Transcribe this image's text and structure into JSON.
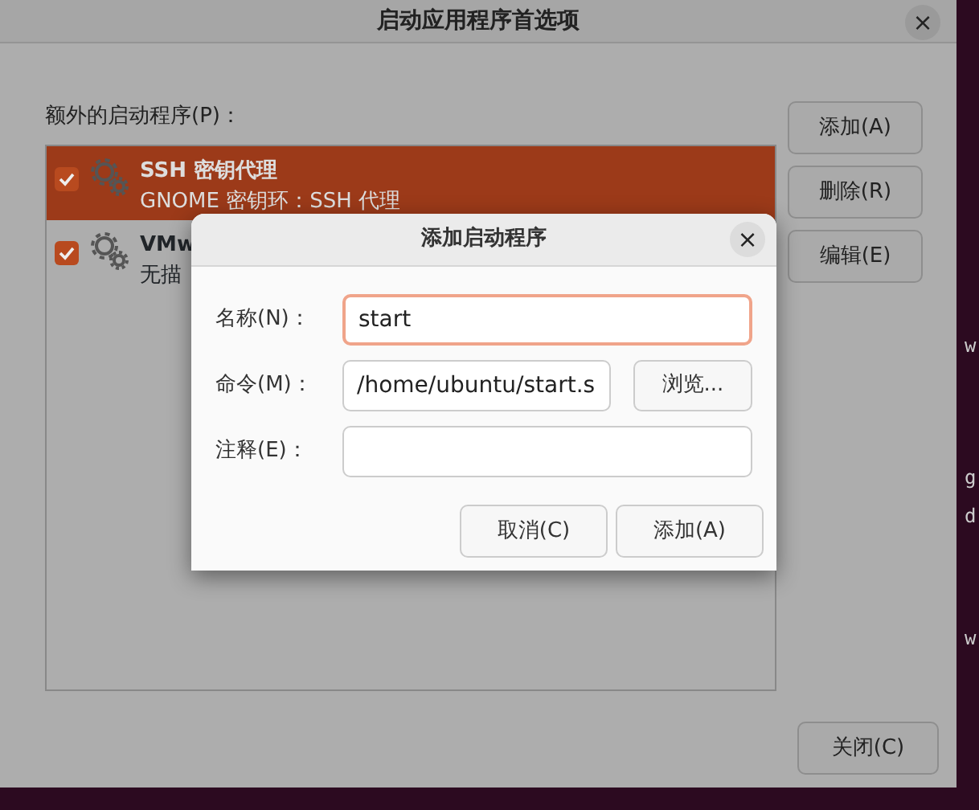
{
  "window": {
    "title": "启动应用程序首选项",
    "close": "×"
  },
  "list_label": "额外的启动程序(P)：",
  "programs": [
    {
      "name": "SSH 密钥代理",
      "description": "GNOME 密钥环：SSH 代理",
      "checked": true,
      "selected": true
    },
    {
      "name": "VMw",
      "description": "无描",
      "checked": true,
      "selected": false
    }
  ],
  "side_buttons": [
    "添加(A)",
    "删除(R)",
    "编辑(E)"
  ],
  "close_button": "关闭(C)",
  "terminal_fragments": [
    "w",
    "g",
    "d",
    "w"
  ],
  "dialog": {
    "title": "添加启动程序",
    "close": "×",
    "fields": [
      {
        "kind": "text",
        "label": "名称(N)：",
        "value": "start",
        "focused": true
      },
      {
        "kind": "browse",
        "label": "命令(M)：",
        "value": "/home/ubuntu/start.s",
        "button": "浏览...",
        "focused": false
      },
      {
        "kind": "text",
        "label": "注释(E)：",
        "focused": false
      }
    ],
    "buttons": [
      "取消(C)",
      "添加(A)"
    ]
  }
}
